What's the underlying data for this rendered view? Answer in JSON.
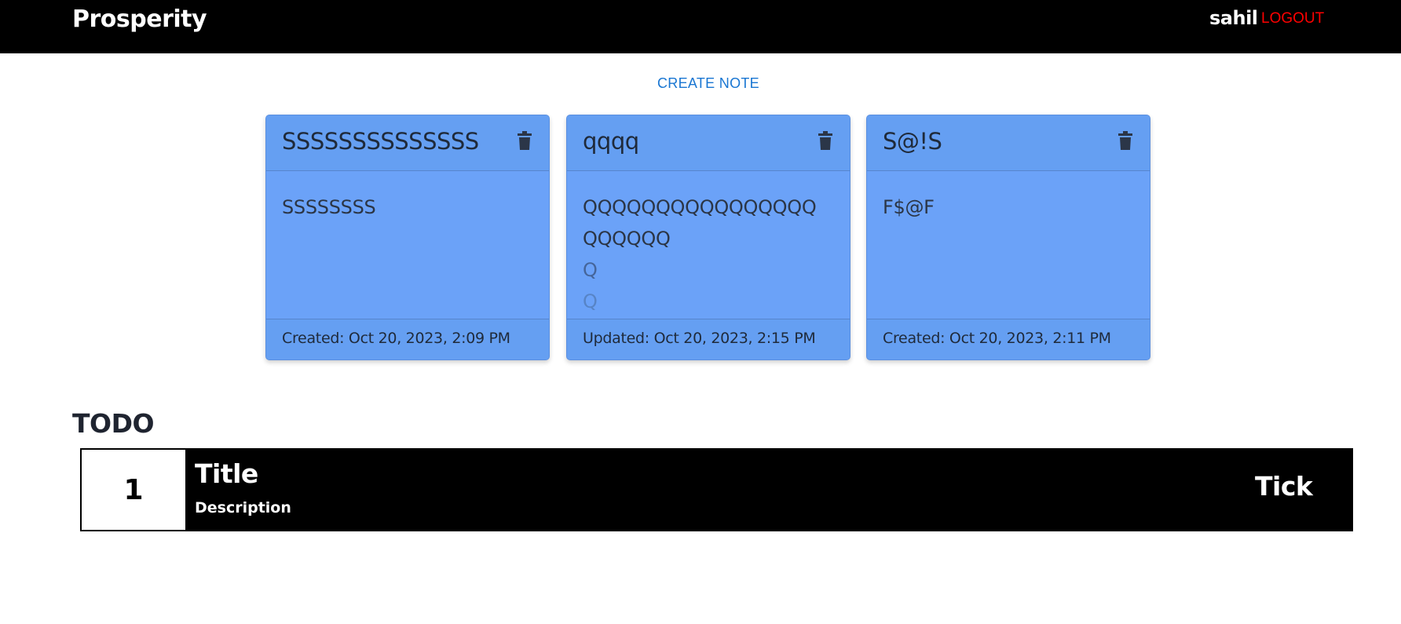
{
  "navbar": {
    "brand": "Prosperity",
    "username": "sahil",
    "logout_label": "LOGOUT"
  },
  "actions": {
    "create_note_label": "CREATE NOTE"
  },
  "notes": [
    {
      "title": "SSSSSSSSSSSSSS",
      "body_lines": [
        "SSSSSSSS"
      ],
      "footer": "Created: Oct 20, 2023, 2:09 PM",
      "delete_icon": "trash-icon"
    },
    {
      "title": "qqqq",
      "body_lines": [
        "QQQQQQQQQQQQQQQQ",
        "QQQQQQ",
        "Q",
        "Q"
      ],
      "footer": "Updated: Oct 20, 2023, 2:15 PM",
      "delete_icon": "trash-icon"
    },
    {
      "title": "S@!S",
      "body_lines": [
        "F$@F"
      ],
      "footer": "Created: Oct 20, 2023, 2:11 PM",
      "delete_icon": "trash-icon"
    }
  ],
  "todo": {
    "heading": "TODO",
    "items": [
      {
        "number": "1",
        "title": "Title",
        "description": "Description",
        "action_label": "Tick"
      }
    ]
  },
  "colors": {
    "navbar_bg": "#000000",
    "logout": "#ff0000",
    "create_note": "#1976d2",
    "card_bg": "#6ba2f8"
  }
}
